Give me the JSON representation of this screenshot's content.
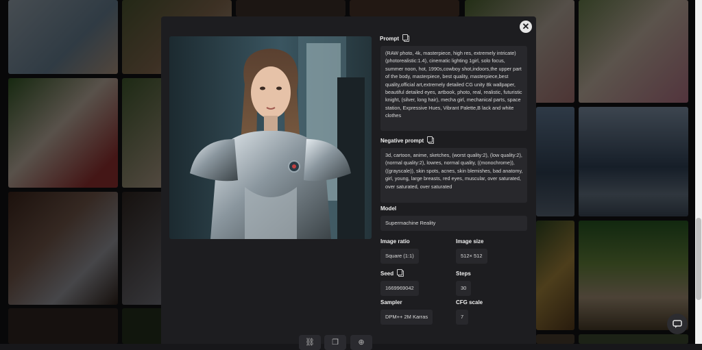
{
  "modal": {
    "close_icon": "close-icon",
    "fields": {
      "prompt": {
        "label": "Prompt",
        "value": "(RAW photo, 4k, masterpiece, high res, extremely intricate) (photorealistic:1.4), cinematic lighting 1girl, solo focus, summer noon, hot, 1990s,cowboy shot,indoors,the upper part of the body, masterpiece, best quality, masterpiece,best quality,official art,extremely detailed CG unity 8k wallpaper, beautiful detailed eyes, artbook, photo, real, realistic, futuristic knight, (silver, long hair), mecha girl, mechanical parts, space station, Expressive Hues, Vibrant Palette,B lack and white clothes"
      },
      "negative_prompt": {
        "label": "Negative prompt",
        "value": "3d, cartoon, anime, sketches, (worst quality:2), (low quality:2), (normal quality:2), lowres, normal quality, ((monochrome)), ((grayscale)), skin spots, acnes, skin blemishes, bad anatomy, girl, young, large breasts, red eyes, muscular, over saturated, over saturated, over saturated"
      },
      "model": {
        "label": "Model",
        "value": "Supermachine Reality"
      },
      "image_ratio": {
        "label": "Image ratio",
        "value": "Square (1:1)"
      },
      "image_size": {
        "label": "Image size",
        "value": "512× 512"
      },
      "seed": {
        "label": "Seed",
        "value": "1669969042"
      },
      "steps": {
        "label": "Steps",
        "value": "30"
      },
      "sampler": {
        "label": "Sampler",
        "value": "DPM++ 2M Karras"
      },
      "cfg_scale": {
        "label": "CFG scale",
        "value": "7"
      }
    },
    "actions": [
      "link-icon",
      "copy-icon",
      "download-icon"
    ]
  },
  "colors": {
    "modal_bg": "#1d1d20",
    "field_bg": "#28282c",
    "page_bg": "#17171a"
  }
}
